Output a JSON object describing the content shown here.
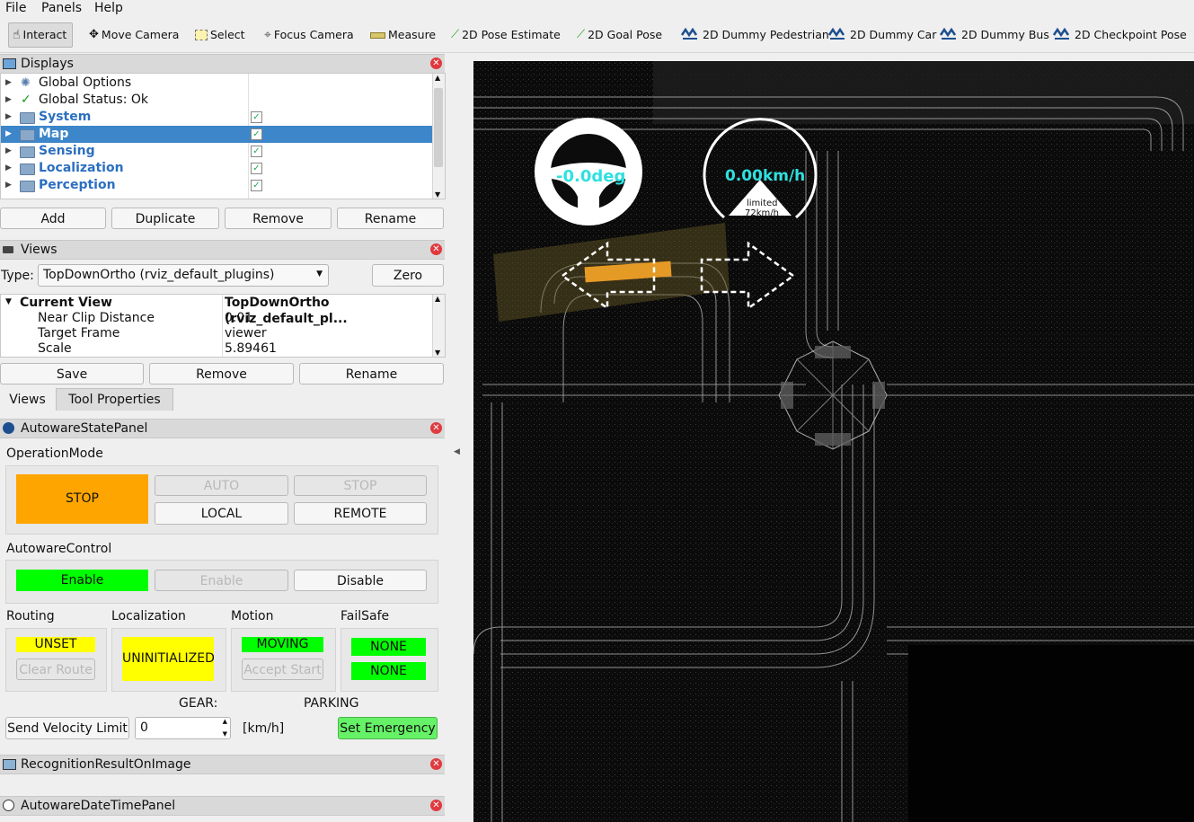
{
  "menubar": {
    "items": [
      "File",
      "Panels",
      "Help"
    ]
  },
  "toolbar": {
    "tools": [
      {
        "label": "Interact",
        "icon": "hand-cursor-icon"
      },
      {
        "label": "Move Camera",
        "icon": "move-camera-icon"
      },
      {
        "label": "Select",
        "icon": "select-rectangle-icon"
      },
      {
        "label": "Focus Camera",
        "icon": "focus-camera-icon"
      },
      {
        "label": "Measure",
        "icon": "ruler-icon"
      },
      {
        "label": "2D Pose Estimate",
        "icon": "green-arrow-icon"
      },
      {
        "label": "2D Goal Pose",
        "icon": "green-arrow-icon"
      },
      {
        "label": "2D Dummy Pedestrian",
        "icon": "autoware-logo-icon"
      },
      {
        "label": "2D Dummy Car",
        "icon": "autoware-logo-icon"
      },
      {
        "label": "2D Dummy Bus",
        "icon": "autoware-logo-icon"
      },
      {
        "label": "2D Checkpoint Pose",
        "icon": "autoware-logo-icon"
      }
    ]
  },
  "displays": {
    "title": "Displays",
    "items": [
      {
        "label": "Global Options",
        "icon": "gear-icon"
      },
      {
        "label": "Global Status: Ok",
        "icon": "check-icon"
      },
      {
        "label": "System",
        "checked": true
      },
      {
        "label": "Map",
        "checked": true,
        "selected": true
      },
      {
        "label": "Sensing",
        "checked": true
      },
      {
        "label": "Localization",
        "checked": true
      },
      {
        "label": "Perception",
        "checked": true
      }
    ],
    "buttons": [
      "Add",
      "Duplicate",
      "Remove",
      "Rename"
    ]
  },
  "views": {
    "title": "Views",
    "type_label": "Type:",
    "type_value": "TopDownOrtho (rviz_default_plugins)",
    "zero_label": "Zero",
    "current_view_label": "Current View",
    "current_view_value": "TopDownOrtho (rviz_default_pl...",
    "properties": [
      {
        "name": "Near Clip Distance",
        "value": "0.01"
      },
      {
        "name": "Target Frame",
        "value": "viewer"
      },
      {
        "name": "Scale",
        "value": "5.89461"
      }
    ],
    "buttons": [
      "Save",
      "Remove",
      "Rename"
    ],
    "tabs": [
      "Views",
      "Tool Properties"
    ]
  },
  "state_panel": {
    "title": "AutowareStatePanel",
    "operation_mode_label": "OperationMode",
    "operation_state": "STOP",
    "auto_label": "AUTO",
    "stop_label": "STOP",
    "local_label": "LOCAL",
    "remote_label": "REMOTE",
    "control_label": "AutowareControl",
    "control_state": "Enable",
    "enable_label": "Enable",
    "disable_label": "Disable",
    "routing_label": "Routing",
    "routing_state": "UNSET",
    "clear_route_label": "Clear Route",
    "localization_label": "Localization",
    "localization_state": "UNINITIALIZED",
    "motion_label": "Motion",
    "motion_state": "MOVING",
    "accept_start_label": "Accept Start",
    "failsafe_label": "FailSafe",
    "failsafe_state_1": "NONE",
    "failsafe_state_2": "NONE",
    "gear_label": "GEAR:",
    "parking_label": "PARKING",
    "send_velocity_label": "Send Velocity Limit",
    "velocity_value": "0",
    "unit_label": "[km/h]",
    "emergency_label": "Set Emergency"
  },
  "recognition_panel": {
    "title": "RecognitionResultOnImage"
  },
  "datetime_panel": {
    "title": "AutowareDateTimePanel"
  },
  "viewport": {
    "steering_text": "-0.0deg",
    "speed_text": "0.00km/h",
    "limit_text_1": "limited",
    "limit_text_2": "72km/h"
  },
  "colors": {
    "stop_orange": "#ffa500",
    "green": "#00ff00",
    "yellow": "#ffff00",
    "selection_blue": "#3d86c9",
    "cyan_text": "#2fe0e0"
  }
}
